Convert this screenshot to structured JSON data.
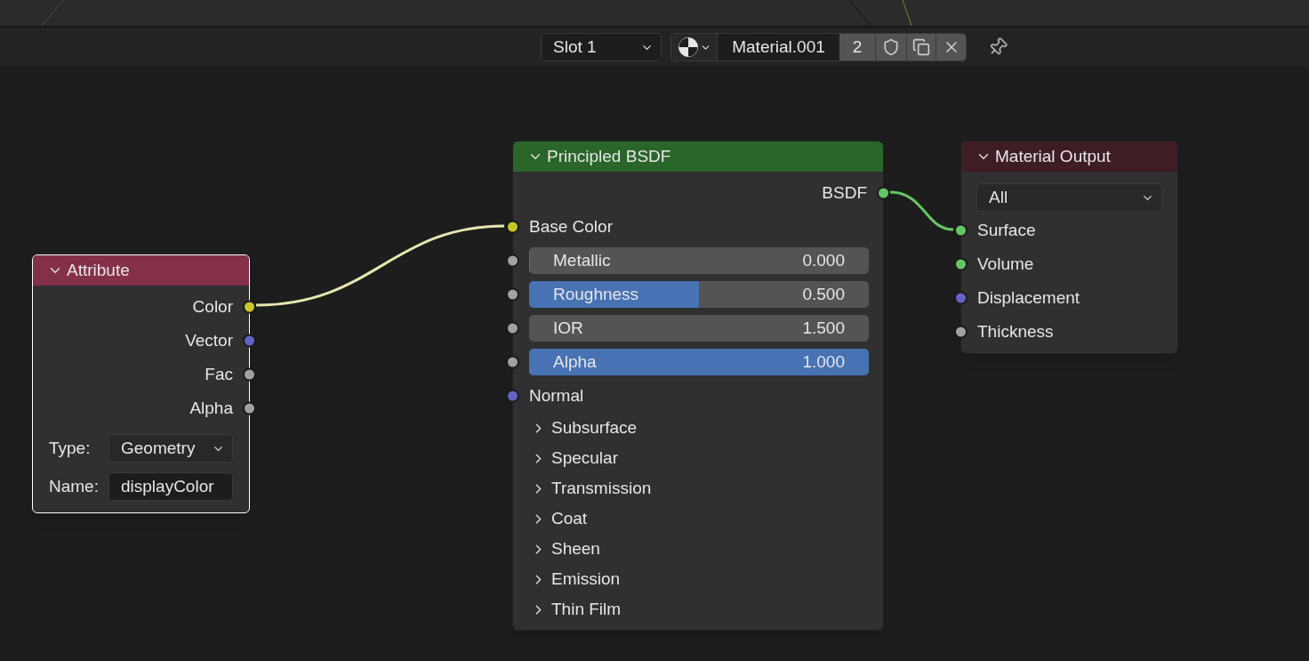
{
  "header": {
    "slot": "Slot 1",
    "material": "Material.001",
    "users": "2"
  },
  "nodes": [
    {
      "kind": "attribute",
      "title": "Attribute",
      "color": "#843048",
      "selected": true,
      "outputs": [
        {
          "label": "Color",
          "color": "#c7c729"
        },
        {
          "label": "Vector",
          "color": "#6363c7"
        },
        {
          "label": "Fac",
          "color": "#a1a1a1"
        },
        {
          "label": "Alpha",
          "color": "#a1a1a1"
        }
      ],
      "fields": [
        {
          "label": "Type:",
          "value": "Geometry",
          "kind": "dropdown"
        },
        {
          "label": "Name:",
          "value": "displayColor",
          "kind": "text"
        }
      ]
    },
    {
      "kind": "bsdf",
      "title": "Principled BSDF",
      "color": "#2a652a",
      "selected": false,
      "outputs": [
        {
          "label": "BSDF",
          "color": "#63c763"
        }
      ],
      "inputs": [
        {
          "kind": "socket",
          "label": "Base Color",
          "color": "#c7c729"
        },
        {
          "kind": "slider",
          "label": "Metallic",
          "value": "0.000",
          "level": 0,
          "color": "#a1a1a1"
        },
        {
          "kind": "slider",
          "label": "Roughness",
          "value": "0.500",
          "level": 0.5,
          "color": "#a1a1a1"
        },
        {
          "kind": "number",
          "label": "IOR",
          "value": "1.500",
          "color": "#a1a1a1"
        },
        {
          "kind": "slider",
          "label": "Alpha",
          "value": "1.000",
          "level": 1,
          "color": "#a1a1a1"
        },
        {
          "kind": "socket",
          "label": "Normal",
          "color": "#6363c7"
        }
      ],
      "panels": [
        {
          "label": "Subsurface",
          "expanded": false
        },
        {
          "label": "Specular",
          "expanded": false
        },
        {
          "label": "Transmission",
          "expanded": false
        },
        {
          "label": "Coat",
          "expanded": false
        },
        {
          "label": "Sheen",
          "expanded": false
        },
        {
          "label": "Emission",
          "expanded": false
        },
        {
          "label": "Thin Film",
          "expanded": false
        }
      ]
    },
    {
      "kind": "output",
      "title": "Material Output",
      "color": "#3e1d25",
      "selected": false,
      "target": "All",
      "inputs": [
        {
          "kind": "socket",
          "label": "Surface",
          "color": "#63c763"
        },
        {
          "kind": "socket",
          "label": "Volume",
          "color": "#63c763"
        },
        {
          "kind": "socket",
          "label": "Displacement",
          "color": "#6363c7"
        },
        {
          "kind": "socket",
          "label": "Thickness",
          "color": "#a1a1a1"
        }
      ]
    }
  ]
}
